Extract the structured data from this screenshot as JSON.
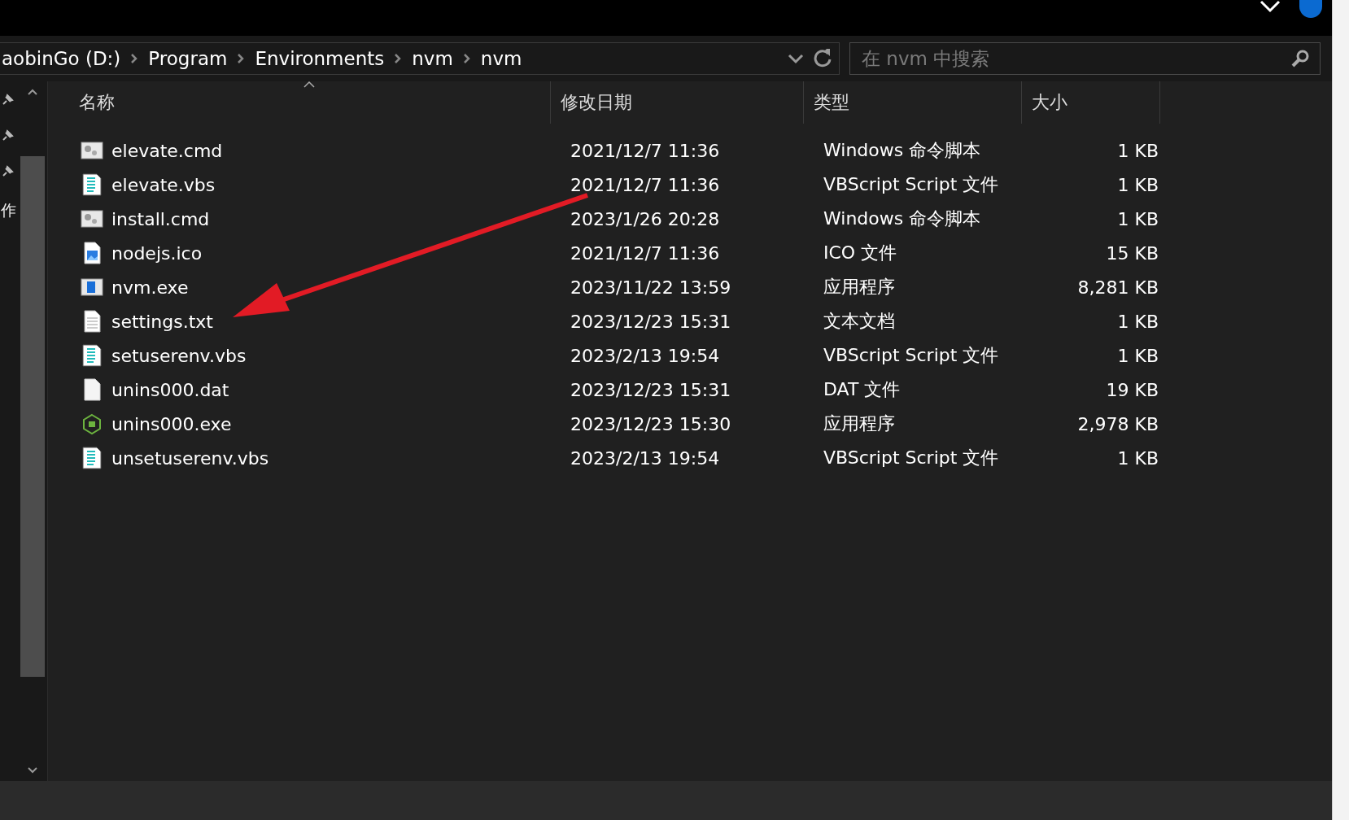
{
  "address_bar": {
    "segments": [
      "aobinGo (D:)",
      "Program",
      "Environments",
      "nvm",
      "nvm"
    ]
  },
  "search": {
    "placeholder": "在 nvm 中搜索"
  },
  "nav_pane": {
    "partial_label": "作"
  },
  "table": {
    "columns": [
      "名称",
      "修改日期",
      "类型",
      "大小"
    ],
    "rows": [
      {
        "kind": "cmd",
        "name": "elevate.cmd",
        "date": "2021/12/7 11:36",
        "type": "Windows 命令脚本",
        "size": "1 KB"
      },
      {
        "kind": "vbs",
        "name": "elevate.vbs",
        "date": "2021/12/7 11:36",
        "type": "VBScript Script 文件",
        "size": "1 KB"
      },
      {
        "kind": "cmd",
        "name": "install.cmd",
        "date": "2023/1/26 20:28",
        "type": "Windows 命令脚本",
        "size": "1 KB"
      },
      {
        "kind": "image",
        "name": "nodejs.ico",
        "date": "2021/12/7 11:36",
        "type": "ICO 文件",
        "size": "15 KB"
      },
      {
        "kind": "app",
        "name": "nvm.exe",
        "date": "2023/11/22 13:59",
        "type": "应用程序",
        "size": "8,281 KB"
      },
      {
        "kind": "text",
        "name": "settings.txt",
        "date": "2023/12/23 15:31",
        "type": "文本文档",
        "size": "1 KB"
      },
      {
        "kind": "vbs",
        "name": "setuserenv.vbs",
        "date": "2023/2/13 19:54",
        "type": "VBScript Script 文件",
        "size": "1 KB"
      },
      {
        "kind": "blank",
        "name": "unins000.dat",
        "date": "2023/12/23 15:31",
        "type": "DAT 文件",
        "size": "19 KB"
      },
      {
        "kind": "node",
        "name": "unins000.exe",
        "date": "2023/12/23 15:30",
        "type": "应用程序",
        "size": "2,978 KB"
      },
      {
        "kind": "vbs",
        "name": "unsetuserenv.vbs",
        "date": "2023/2/13 19:54",
        "type": "VBScript Script 文件",
        "size": "1 KB"
      }
    ]
  }
}
